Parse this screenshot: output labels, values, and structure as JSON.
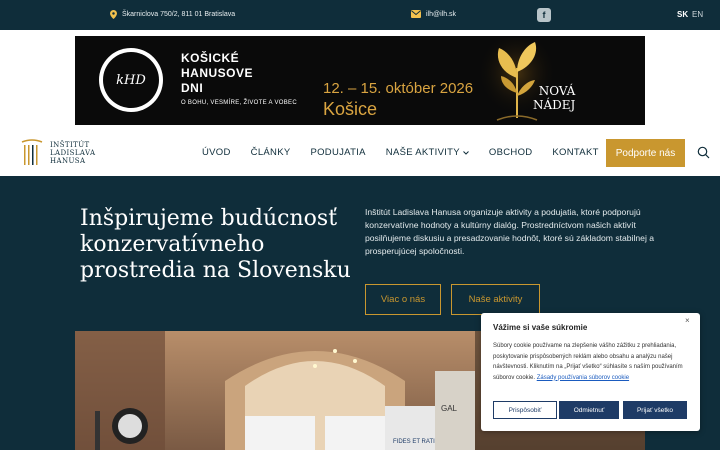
{
  "topbar": {
    "address": "Škarniclova 750/2, 811 01 Bratislava",
    "email": "ilh@ilh.sk",
    "facebook_glyph": "f",
    "lang_sk": "SK",
    "lang_en": "EN",
    "icons": {
      "address": "map-pin-icon",
      "email": "envelope-icon",
      "facebook": "facebook-icon"
    }
  },
  "banner": {
    "logo_text": "kHD",
    "title_line1": "KOŠICKÉ",
    "title_line2": "HANUSOVE",
    "title_line3": "DNI",
    "subtitle": "O BOHU, VESMÍRE, ŽIVOTE A VOBEC",
    "dates": "12. – 15. október 2026",
    "city": "Košice",
    "tagline_line1": "NOVÁ",
    "tagline_line2": "NÁDEJ"
  },
  "header": {
    "brand_line1": "INŠTITÚT",
    "brand_line2": "LADISLAVA",
    "brand_line3": "HANUSA",
    "nav": [
      {
        "label": "ÚVOD"
      },
      {
        "label": "ČLÁNKY"
      },
      {
        "label": "PODUJATIA"
      },
      {
        "label": "NAŠE AKTIVITY",
        "has_dropdown": true
      },
      {
        "label": "OBCHOD"
      },
      {
        "label": "KONTAKT"
      }
    ],
    "cta_label": "Podporte nás"
  },
  "hero": {
    "heading": "Inšpirujeme budúcnosť konzervatívneho prostredia na Slovensku",
    "description": "Inštitút Ladislava Hanusa organizuje aktivity a podujatia, ktoré podporujú konzervatívne hodnoty a kultúrny dialóg. Prostredníctvom našich aktivít posilňujeme diskusiu a presadzovanie hodnôt, ktoré sú základom stabilnej a prosperujúcej spoločnosti.",
    "button_about": "Viac o nás",
    "button_activities": "Naše aktivity",
    "photo_sign": "FIDES ET RATIO",
    "photo_letters": "GAL"
  },
  "cookie": {
    "title": "Vážime si vaše súkromie",
    "text": "Súbory cookie používame na zlepšenie vášho zážitku z prehliadania, poskytovanie prispôsobených reklám alebo obsahu a analýzu našej návštevnosti. Kliknutím na „Prijať všetko“ súhlasíte s naším používaním súborov cookie.",
    "link": "Zásady používania súborov cookie",
    "btn_customize": "Prispôsobiť",
    "btn_reject": "Odmietnuť",
    "btn_accept": "Prijať všetko",
    "close_glyph": "×"
  },
  "colors": {
    "navy": "#0f2d3a",
    "gold": "#c9972f",
    "cookie_button": "#1e3b66"
  }
}
